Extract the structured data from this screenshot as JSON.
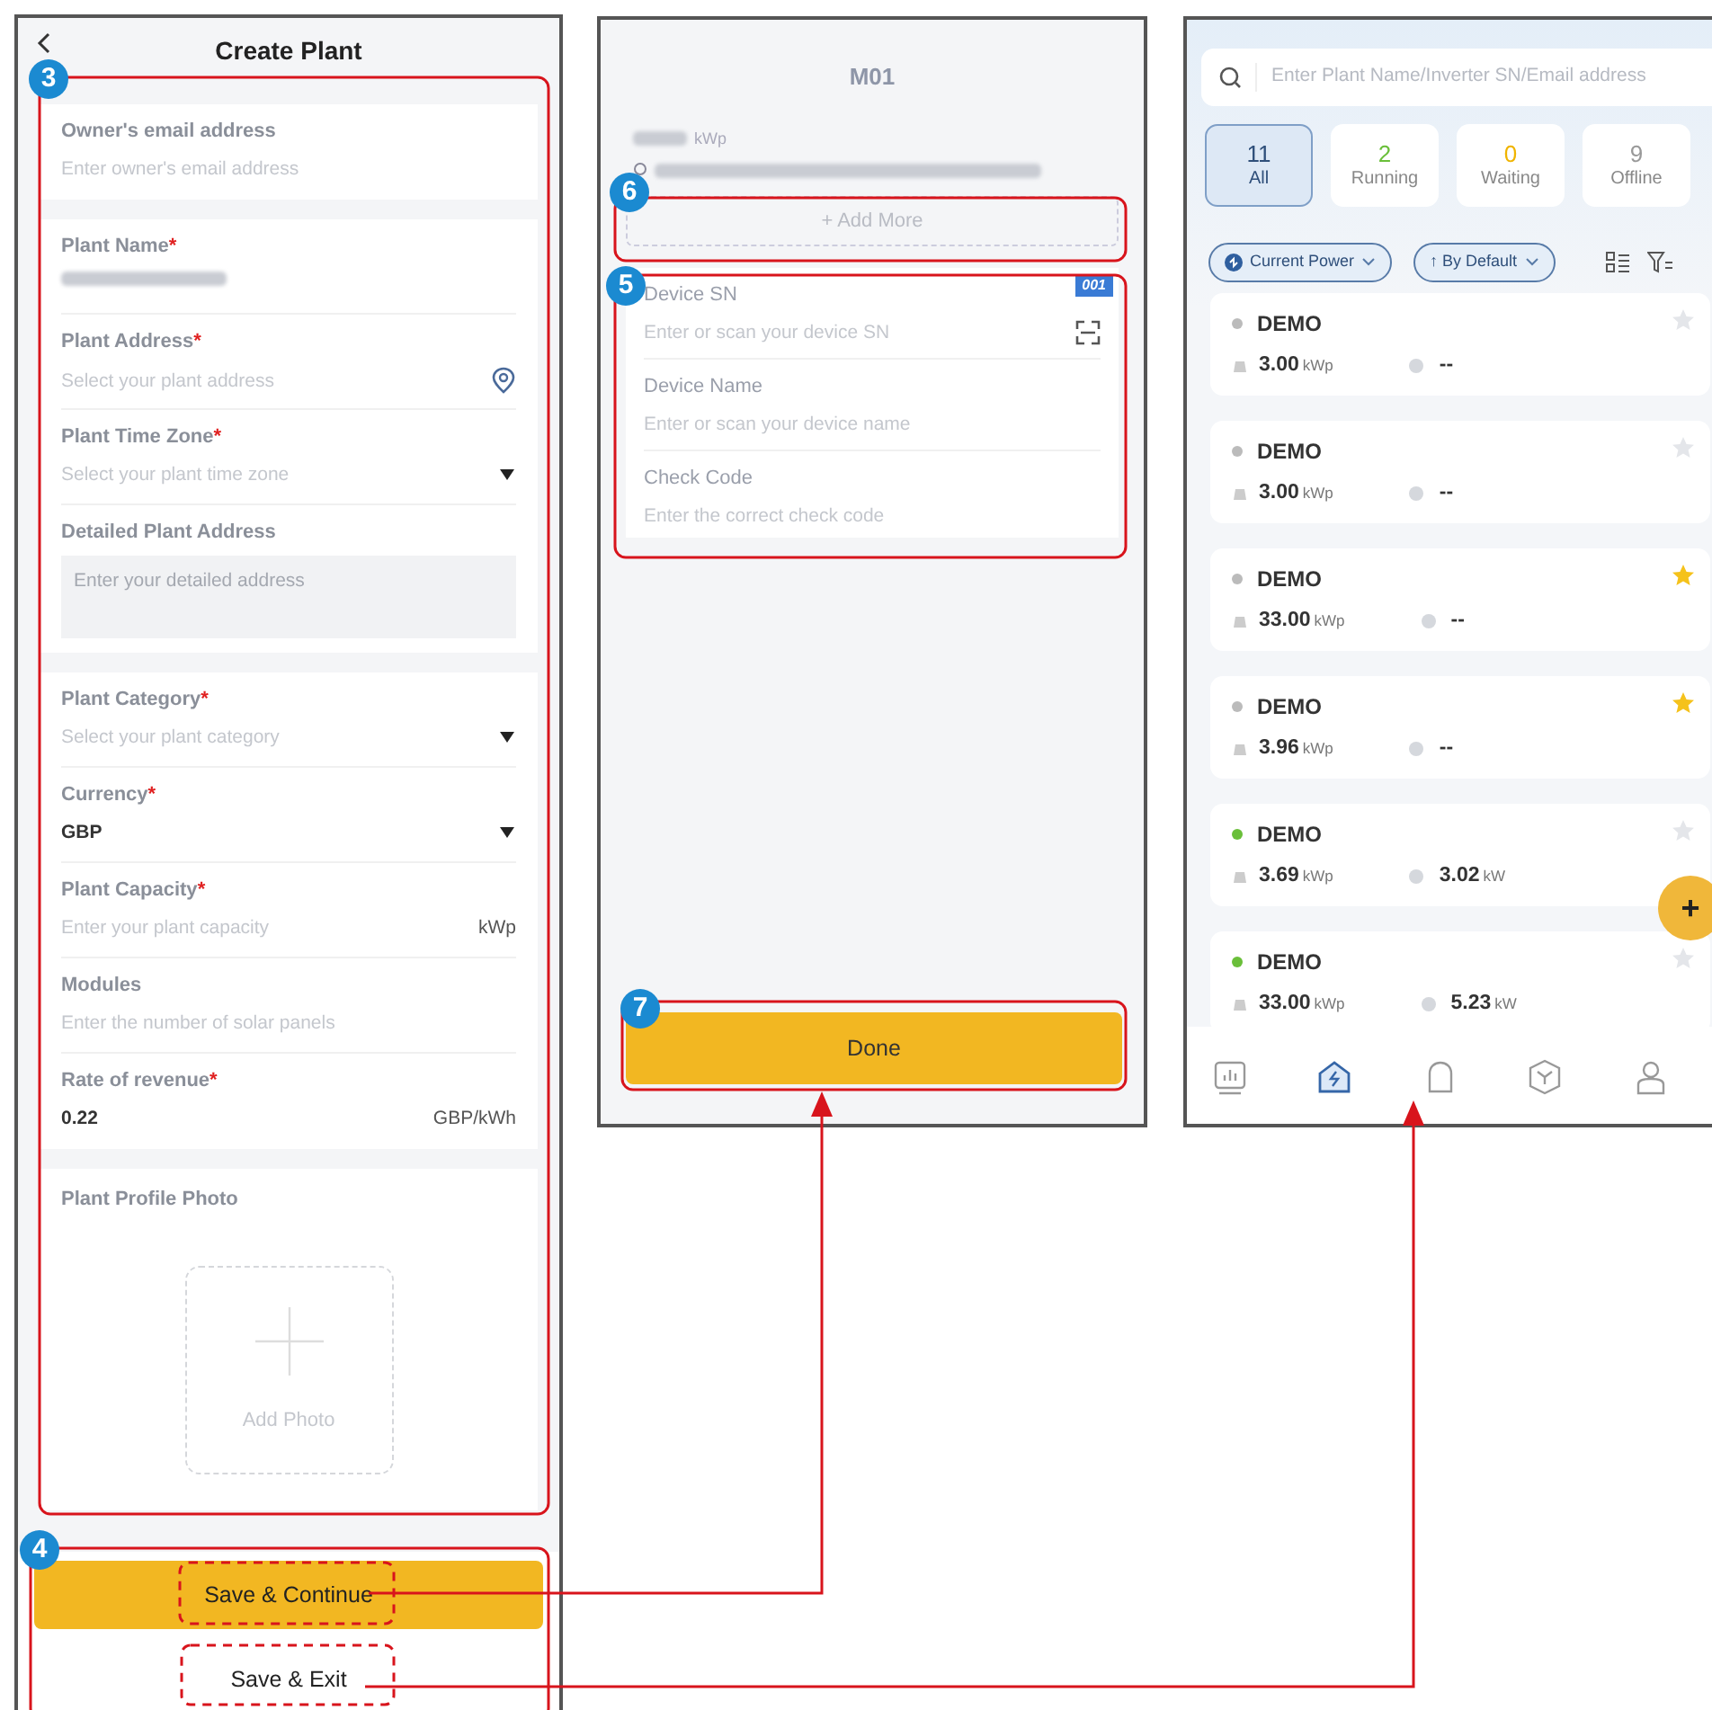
{
  "create_plant": {
    "title": "Create Plant",
    "sections": [
      {
        "fields": [
          {
            "kind": "input",
            "label": "Owner's email address",
            "placeholder": "Enter owner's email address"
          }
        ]
      },
      {
        "fields": [
          {
            "kind": "redacted",
            "label": "Plant Name",
            "required_mark": "*"
          },
          {
            "kind": "location",
            "label": "Plant Address",
            "required_mark": "*",
            "placeholder": "Select your plant address"
          },
          {
            "kind": "select",
            "label": "Plant Time Zone",
            "required_mark": "*",
            "placeholder": "Select your plant time zone"
          },
          {
            "kind": "textarea",
            "label": "Detailed Plant Address",
            "placeholder": "Enter your detailed address"
          }
        ]
      },
      {
        "fields": [
          {
            "kind": "select",
            "label": "Plant Category",
            "required_mark": "*",
            "placeholder": "Select your plant category"
          },
          {
            "kind": "select",
            "label": "Currency",
            "required_mark": "*",
            "value": "GBP"
          },
          {
            "kind": "input",
            "label": "Plant Capacity",
            "required_mark": "*",
            "placeholder": "Enter your plant capacity",
            "unit": "kWp"
          },
          {
            "kind": "input",
            "label": "Modules",
            "placeholder": "Enter the number of solar panels"
          },
          {
            "kind": "input",
            "label": "Rate of revenue",
            "required_mark": "*",
            "value": "0.22",
            "unit": "GBP/kWh"
          }
        ]
      }
    ],
    "photo": {
      "label": "Plant Profile Photo",
      "button": "Add Photo"
    },
    "buttons": [
      {
        "label": "Save & Continue",
        "kind": "primary"
      },
      {
        "label": "Save & Exit",
        "kind": "plain"
      }
    ]
  },
  "device_screen": {
    "title": "M01",
    "capacity_unit": "kWp",
    "add_more": "+ Add More",
    "tag": "001",
    "fields": [
      {
        "label": "Device SN",
        "placeholder": "Enter or scan your device SN",
        "kind": "scan"
      },
      {
        "label": "Device Name",
        "placeholder": "Enter or scan your device name",
        "kind": "input"
      },
      {
        "label": "Check Code",
        "placeholder": "Enter the correct check code",
        "kind": "input"
      }
    ],
    "button": "Done"
  },
  "plant_list": {
    "search_placeholder": "Enter Plant Name/Inverter SN/Email address",
    "status_tabs": [
      {
        "count": "11",
        "label": "All",
        "selected": true,
        "color": "#2f4f7a"
      },
      {
        "count": "2",
        "label": "Running",
        "selected": false,
        "color": "#6abf3a"
      },
      {
        "count": "0",
        "label": "Waiting",
        "selected": false,
        "color": "#f0b400"
      },
      {
        "count": "9",
        "label": "Offline",
        "selected": false,
        "color": "#999999"
      }
    ],
    "filters": [
      {
        "label": "Current Power",
        "kind": "power"
      },
      {
        "label": "↑ By Default",
        "kind": "sort"
      }
    ],
    "plants": [
      {
        "name": "DEMO",
        "color": "#bbbbbb",
        "capacity": "3.00",
        "capacity_unit": "kWp",
        "power": "--",
        "starred": false
      },
      {
        "name": "DEMO",
        "color": "#bbbbbb",
        "capacity": "3.00",
        "capacity_unit": "kWp",
        "power": "--",
        "starred": false
      },
      {
        "name": "DEMO",
        "color": "#bbbbbb",
        "capacity": "33.00",
        "capacity_unit": "kWp",
        "power": "--",
        "starred": true
      },
      {
        "name": "DEMO",
        "color": "#bbbbbb",
        "capacity": "3.96",
        "capacity_unit": "kWp",
        "power": "--",
        "starred": true
      },
      {
        "name": "DEMO",
        "color": "#6abf3a",
        "capacity": "3.69",
        "capacity_unit": "kWp",
        "power": "3.02",
        "power_unit": "kW",
        "starred": false
      },
      {
        "name": "DEMO",
        "color": "#6abf3a",
        "capacity": "33.00",
        "capacity_unit": "kWp",
        "power": "5.23",
        "power_unit": "kW",
        "starred": false
      }
    ],
    "fab": "+",
    "nav": [
      {
        "kind": "chart",
        "selected": false
      },
      {
        "kind": "home",
        "selected": true
      },
      {
        "kind": "bell",
        "selected": false
      },
      {
        "kind": "cube",
        "selected": false
      },
      {
        "kind": "user",
        "selected": false
      }
    ]
  },
  "callouts": [
    {
      "number": "3"
    },
    {
      "number": "4"
    },
    {
      "number": "5"
    },
    {
      "number": "6"
    },
    {
      "number": "7"
    }
  ]
}
